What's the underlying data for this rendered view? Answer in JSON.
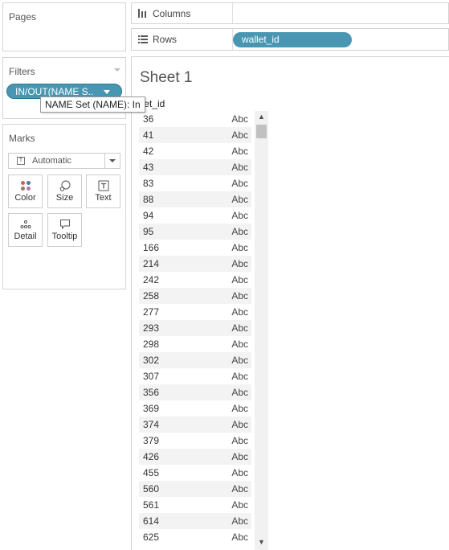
{
  "pages": {
    "title": "Pages"
  },
  "filters": {
    "title": "Filters",
    "pill_label": "IN/OUT(NAME S..",
    "tooltip": "NAME Set (NAME): In"
  },
  "marks": {
    "title": "Marks",
    "type_label": "Automatic",
    "type_icon": "T",
    "buttons": {
      "color": "Color",
      "size": "Size",
      "text": "Text",
      "detail": "Detail",
      "tooltip": "Tooltip"
    }
  },
  "columns": {
    "label": "Columns"
  },
  "rows": {
    "label": "Rows",
    "pill_label": "wallet_id"
  },
  "sheet": {
    "title": "Sheet 1",
    "column_header": "llet_id",
    "rows": [
      {
        "id": "36",
        "value": "Abc"
      },
      {
        "id": "41",
        "value": "Abc"
      },
      {
        "id": "42",
        "value": "Abc"
      },
      {
        "id": "43",
        "value": "Abc"
      },
      {
        "id": "83",
        "value": "Abc"
      },
      {
        "id": "88",
        "value": "Abc"
      },
      {
        "id": "94",
        "value": "Abc"
      },
      {
        "id": "95",
        "value": "Abc"
      },
      {
        "id": "166",
        "value": "Abc"
      },
      {
        "id": "214",
        "value": "Abc"
      },
      {
        "id": "242",
        "value": "Abc"
      },
      {
        "id": "258",
        "value": "Abc"
      },
      {
        "id": "277",
        "value": "Abc"
      },
      {
        "id": "293",
        "value": "Abc"
      },
      {
        "id": "298",
        "value": "Abc"
      },
      {
        "id": "302",
        "value": "Abc"
      },
      {
        "id": "307",
        "value": "Abc"
      },
      {
        "id": "356",
        "value": "Abc"
      },
      {
        "id": "369",
        "value": "Abc"
      },
      {
        "id": "374",
        "value": "Abc"
      },
      {
        "id": "379",
        "value": "Abc"
      },
      {
        "id": "426",
        "value": "Abc"
      },
      {
        "id": "455",
        "value": "Abc"
      },
      {
        "id": "560",
        "value": "Abc"
      },
      {
        "id": "561",
        "value": "Abc"
      },
      {
        "id": "614",
        "value": "Abc"
      },
      {
        "id": "625",
        "value": "Abc"
      }
    ]
  },
  "colors": {
    "pill": "#4996b2",
    "row_stripe": "#f3f3f3",
    "border": "#d4d4d4"
  }
}
